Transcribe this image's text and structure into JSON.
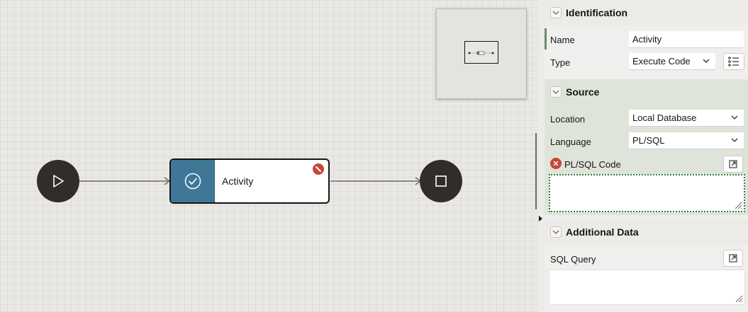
{
  "canvas": {
    "start_icon": "play-icon",
    "end_icon": "stop-icon",
    "activity": {
      "label": "Activity",
      "icon": "check-circle-icon",
      "status_icon": "error-badge-icon",
      "icon_bg_color": "#3f7797",
      "error_color": "#c74634"
    },
    "overview_icon": "minimap"
  },
  "panel": {
    "identification": {
      "title": "Identification",
      "name_label": "Name",
      "name_value": "Activity",
      "type_label": "Type",
      "type_value": "Execute Code",
      "type_list_icon": "list-icon"
    },
    "source": {
      "title": "Source",
      "location_label": "Location",
      "location_value": "Local Database",
      "language_label": "Language",
      "language_value": "PL/SQL",
      "code_label": "PL/SQL Code",
      "code_value": "",
      "expand_icon": "open-editor-icon"
    },
    "additional_data": {
      "title": "Additional Data",
      "sql_label": "SQL Query",
      "sql_value": "",
      "expand_icon": "open-editor-icon"
    }
  }
}
